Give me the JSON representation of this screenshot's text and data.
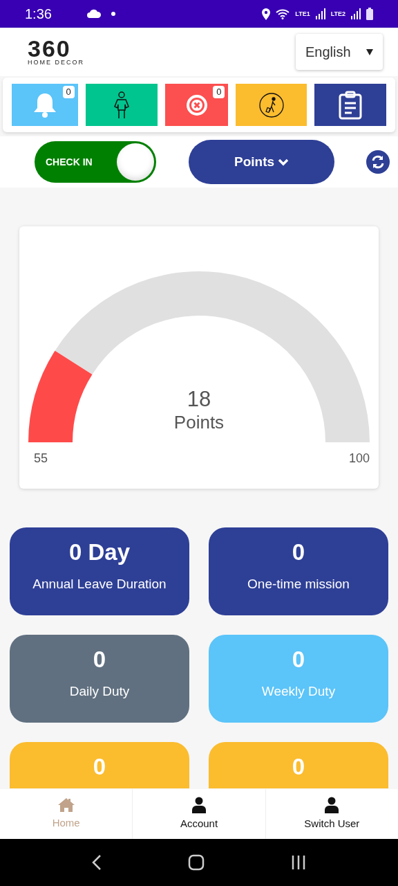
{
  "status_bar": {
    "time": "1:36",
    "sim_1": "LTE1",
    "sim_2": "LTE2"
  },
  "header": {
    "logo_number": "360",
    "logo_tagline": "HOME DECOR",
    "language": "English"
  },
  "quick_tiles": [
    {
      "kind": "bell",
      "color": "#5bc4f9",
      "badge": "0"
    },
    {
      "kind": "person",
      "color": "#00c58e"
    },
    {
      "kind": "cancel",
      "color": "#fc4f4f",
      "badge": "0"
    },
    {
      "kind": "traveler",
      "color": "#fbbc2e"
    },
    {
      "kind": "clipboard",
      "color": "#2e3f96"
    }
  ],
  "check_toggle": {
    "label": "CHECK IN",
    "on": true
  },
  "view_dropdown": {
    "label": "Points"
  },
  "gauge": {
    "value": "18",
    "unit": "Points",
    "min": "55",
    "max": "100"
  },
  "cards": [
    {
      "value": "0 Day",
      "label": "Annual Leave Duration",
      "color": "#2e3f96"
    },
    {
      "value": "0",
      "label": "One-time mission",
      "color": "#2e3f96"
    },
    {
      "value": "0",
      "label": "Daily Duty",
      "color": "#607080"
    },
    {
      "value": "0",
      "label": "Weekly Duty",
      "color": "#5bc4f9"
    },
    {
      "value": "0",
      "color": "#fbbc2e"
    },
    {
      "value": "0",
      "color": "#fbbc2e"
    }
  ],
  "bottom_nav": [
    {
      "kind": "home",
      "label": "Home",
      "selected": true
    },
    {
      "kind": "user",
      "label": "Account",
      "selected": false
    },
    {
      "kind": "user",
      "label": "Switch User",
      "selected": false
    }
  ]
}
